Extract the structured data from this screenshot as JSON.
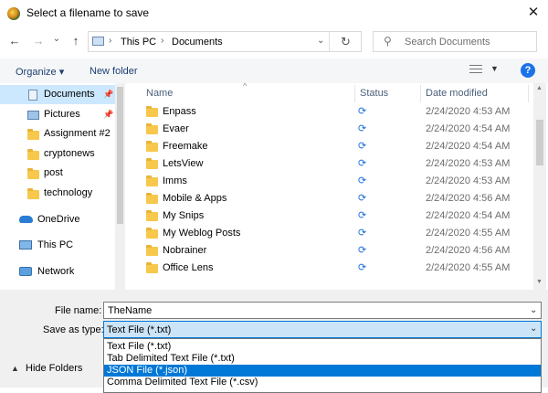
{
  "window": {
    "title": "Select a filename to save",
    "close_glyph": "✕"
  },
  "nav": {
    "back": "←",
    "forward": "→",
    "recent": "⌄",
    "up": "↑",
    "breadcrumb": [
      "This PC",
      "Documents"
    ],
    "refresh": "↻",
    "search_placeholder": "Search Documents"
  },
  "toolbar": {
    "organize": "Organize ▾",
    "new_folder": "New folder",
    "help": "?"
  },
  "navpane": {
    "items": [
      {
        "label": "Documents",
        "icon": "documents-icon",
        "pinned": true,
        "selected": true
      },
      {
        "label": "Pictures",
        "icon": "pictures-icon",
        "pinned": true
      },
      {
        "label": "Assignment #2",
        "icon": "folder-icon"
      },
      {
        "label": "cryptonews",
        "icon": "folder-icon"
      },
      {
        "label": "post",
        "icon": "folder-icon"
      },
      {
        "label": "technology",
        "icon": "folder-icon"
      },
      {
        "label": "OneDrive",
        "icon": "onedrive-icon"
      },
      {
        "label": "This PC",
        "icon": "this-pc-icon"
      },
      {
        "label": "Network",
        "icon": "network-icon"
      }
    ]
  },
  "filelist": {
    "headers": {
      "name": "Name",
      "status": "Status",
      "date": "Date modified"
    },
    "rows": [
      {
        "name": "Enpass",
        "date": "2/24/2020 4:53 AM"
      },
      {
        "name": "Evaer",
        "date": "2/24/2020 4:54 AM"
      },
      {
        "name": "Freemake",
        "date": "2/24/2020 4:54 AM"
      },
      {
        "name": "LetsView",
        "date": "2/24/2020 4:53 AM"
      },
      {
        "name": "Imms",
        "date": "2/24/2020 4:53 AM"
      },
      {
        "name": "Mobile & Apps",
        "date": "2/24/2020 4:56 AM"
      },
      {
        "name": "My Snips",
        "date": "2/24/2020 4:54 AM"
      },
      {
        "name": "My Weblog Posts",
        "date": "2/24/2020 4:55 AM"
      },
      {
        "name": "Nobrainer",
        "date": "2/24/2020 4:56 AM"
      },
      {
        "name": "Office Lens",
        "date": "2/24/2020 4:55 AM"
      }
    ],
    "status_glyph": "⟳"
  },
  "bottom": {
    "file_name_label": "File name:",
    "file_name_value": "TheName",
    "save_type_label": "Save as type:",
    "save_type_value": "Text File (*.txt)",
    "hide_folders": "Hide Folders",
    "options": [
      "Text File (*.txt)",
      "Tab Delimited Text File (*.txt)",
      "JSON File (*.json)",
      "Comma Delimited Text File (*.csv)"
    ],
    "selected_option_index": 2
  },
  "colors": {
    "accent": "#0078d7",
    "selection": "#cce4f7",
    "folder": "#f7c84c"
  }
}
